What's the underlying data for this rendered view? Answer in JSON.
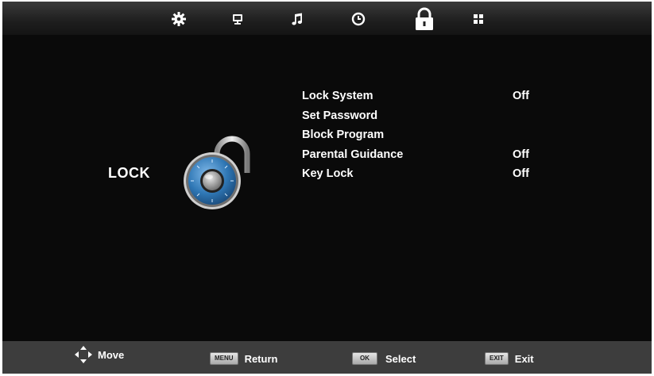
{
  "topbar": {
    "tabs": [
      {
        "name": "picture",
        "icon": "gear-icon"
      },
      {
        "name": "screen",
        "icon": "monitor-icon"
      },
      {
        "name": "sound",
        "icon": "music-note-icon"
      },
      {
        "name": "time",
        "icon": "clock-icon"
      },
      {
        "name": "lock",
        "icon": "padlock-icon",
        "active": true
      },
      {
        "name": "setup",
        "icon": "grid-icon"
      }
    ]
  },
  "section": {
    "title": "LOCK",
    "icon": "combination-lock-icon"
  },
  "menu": {
    "items": [
      {
        "label": "Lock System",
        "value": "Off"
      },
      {
        "label": "Set Password",
        "value": ""
      },
      {
        "label": "Block Program",
        "value": ""
      },
      {
        "label": "Parental Guidance",
        "value": "Off"
      },
      {
        "label": "Key Lock",
        "value": "Off"
      }
    ]
  },
  "footer": {
    "move": {
      "icon": "dpad-arrows-icon",
      "label": "Move"
    },
    "return": {
      "key": "MENU",
      "label": "Return"
    },
    "select": {
      "key": "OK",
      "label": "Select"
    },
    "exit": {
      "key": "EXIT",
      "label": "Exit"
    }
  },
  "colors": {
    "background": "#0a0a0a",
    "footer": "#3d3d3d",
    "text": "#ffffff",
    "lock_blue": "#2f77b5"
  }
}
